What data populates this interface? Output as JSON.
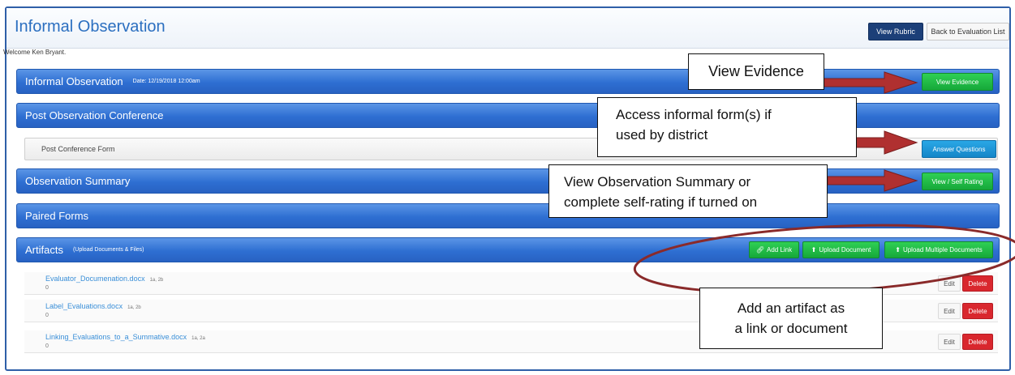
{
  "header": {
    "title": "Informal Observation",
    "view_rubric": "View Rubric",
    "back_to_list": "Back to Evaluation List"
  },
  "welcome": "Welcome Ken Bryant.",
  "sections": {
    "informal": {
      "title": "Informal Observation",
      "date": "Date: 12/19/2018 12:00am",
      "button": "View Evidence"
    },
    "post_conference": {
      "title": "Post Observation Conference",
      "form_label": "Post Conference Form",
      "button": "Answer Questions"
    },
    "summary": {
      "title": "Observation Summary",
      "button": "View / Self Rating"
    },
    "paired": {
      "title": "Paired Forms"
    },
    "artifacts": {
      "title": "Artifacts",
      "subtitle": "(Upload Documents & Files)",
      "add_link": "Add Link",
      "upload_document": "Upload Document",
      "upload_multiple": "Upload Multiple Documents"
    }
  },
  "artifacts": [
    {
      "name": "Evaluator_Documenation.docx",
      "tags": "1a, 2b",
      "count": "0",
      "edit": "Edit",
      "delete": "Delete"
    },
    {
      "name": "Label_Evaluations.docx",
      "tags": "1a, 2b",
      "count": "0",
      "edit": "Edit",
      "delete": "Delete"
    },
    {
      "name": "Linking_Evaluations_to_a_Summative.docx",
      "tags": "1a, 2a",
      "count": "0",
      "edit": "Edit",
      "delete": "Delete"
    }
  ],
  "callouts": {
    "evidence": "View Evidence",
    "forms": [
      "Access informal form(s) if",
      "used by district"
    ],
    "summary": [
      "View Observation Summary or",
      "complete self-rating if turned on"
    ],
    "artifact": [
      "Add an artifact as",
      "a link or document"
    ]
  },
  "icons": {
    "add_link": "link-icon",
    "upload_document": "upload-icon",
    "upload_multiple": "upload-icon"
  },
  "colors": {
    "accent_blue": "#2e6fd2",
    "green_button": "#16a83a",
    "blue_button": "#1586c8",
    "delete_red": "#d9272e",
    "arrow_red": "#b03030",
    "annotation_ellipse": "#8a2a2a"
  }
}
